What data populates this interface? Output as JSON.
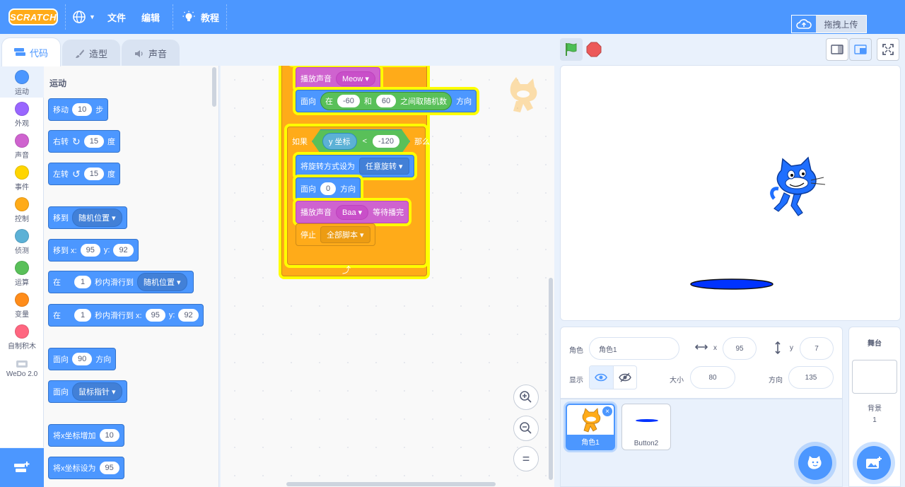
{
  "menubar": {
    "logo": "SCRATCH",
    "file": "文件",
    "edit": "编辑",
    "tutorials": "教程",
    "upload": "拖拽上传"
  },
  "tabs": {
    "code": "代码",
    "costumes": "造型",
    "sounds": "声音"
  },
  "categories": [
    {
      "label": "运动",
      "color": "#4c97ff"
    },
    {
      "label": "外观",
      "color": "#9966ff"
    },
    {
      "label": "声音",
      "color": "#cf63cf"
    },
    {
      "label": "事件",
      "color": "#ffd500"
    },
    {
      "label": "控制",
      "color": "#ffab19"
    },
    {
      "label": "侦测",
      "color": "#5cb1d6"
    },
    {
      "label": "运算",
      "color": "#59c059"
    },
    {
      "label": "变量",
      "color": "#ff8c1a"
    },
    {
      "label": "自制积木",
      "color": "#ff6680"
    },
    {
      "label": "WeDo 2.0",
      "color": "#ffffff"
    }
  ],
  "palette": {
    "title": "运动",
    "move": {
      "a": "移动",
      "v": "10",
      "b": "步"
    },
    "turn_right": {
      "a": "右转",
      "v": "15",
      "b": "度"
    },
    "turn_left": {
      "a": "左转",
      "v": "15",
      "b": "度"
    },
    "goto": {
      "a": "移到",
      "dd": "随机位置"
    },
    "goto_xy": {
      "a": "移到 x:",
      "x": "95",
      "b": "y:",
      "y": "92"
    },
    "glide": {
      "a": "在",
      "v": "1",
      "b": "秒内滑行到",
      "dd": "随机位置"
    },
    "glide_xy": {
      "a": "在",
      "v": "1",
      "b": "秒内滑行到 x:",
      "x": "95",
      "c": "y:",
      "y": "92"
    },
    "point_dir": {
      "a": "面向",
      "v": "90",
      "b": "方向"
    },
    "point_towards": {
      "a": "面向",
      "dd": "鼠标指针"
    },
    "change_x": {
      "a": "将x坐标增加",
      "v": "10"
    },
    "set_x": {
      "a": "将x坐标设为",
      "v": "95"
    }
  },
  "script": {
    "play_meow": {
      "a": "播放声音",
      "dd": "Meow"
    },
    "point_random": {
      "a": "面向",
      "b": "在",
      "v1": "-60",
      "c": "和",
      "v2": "60",
      "d": "之间取随机数",
      "e": "方向"
    },
    "if_label": "如果",
    "cond": {
      "a": "y 坐标",
      "op": "<",
      "v": "-120"
    },
    "then_label": "那么",
    "rot_style": {
      "a": "将旋转方式设为",
      "dd": "任意旋转"
    },
    "point_zero": {
      "a": "面向",
      "v": "0",
      "b": "方向"
    },
    "play_baa": {
      "a": "播放声音",
      "dd": "Baa",
      "b": "等待播完"
    },
    "stop": {
      "a": "停止",
      "dd": "全部脚本"
    },
    "loop_arrow": "⤴"
  },
  "zoom": {
    "in": "+",
    "out": "−",
    "reset": "="
  },
  "sprite_info": {
    "sprite_label": "角色",
    "sprite_name": "角色1",
    "x_label": "x",
    "x": "95",
    "y_label": "y",
    "y": "7",
    "show_label": "显示",
    "size_label": "大小",
    "size": "80",
    "dir_label": "方向",
    "dir": "135"
  },
  "sprites": [
    {
      "name": "角色1"
    },
    {
      "name": "Button2"
    }
  ],
  "stage_panel": {
    "title": "舞台",
    "backdrops_label": "背景",
    "backdrops_count": "1"
  },
  "colors": {
    "accent": "#4c97ff",
    "motion": "#4c97ff",
    "control": "#ffab19",
    "sound": "#cf63cf",
    "operators": "#59c059",
    "highlight": "#ffff00"
  }
}
